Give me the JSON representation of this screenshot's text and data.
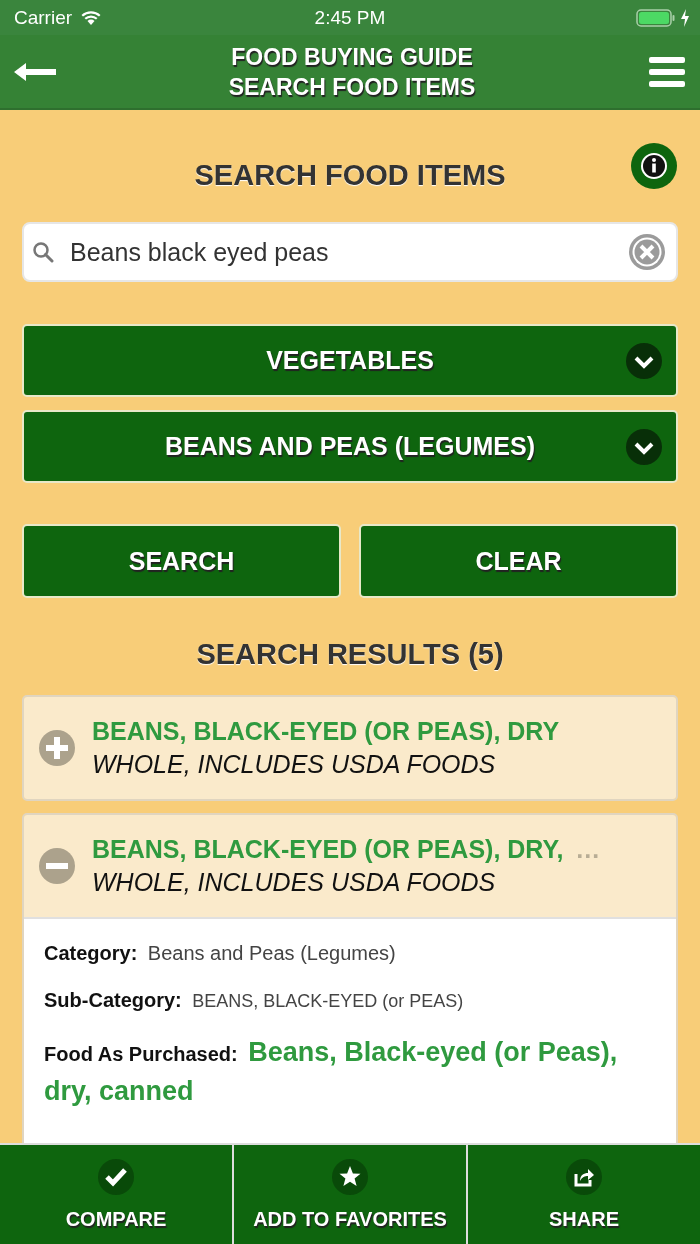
{
  "status_bar": {
    "carrier": "Carrier",
    "time": "2:45 PM",
    "charging": true
  },
  "header": {
    "title_lines": [
      "FOOD BUYING GUIDE",
      "SEARCH FOOD ITEMS"
    ]
  },
  "page_title": "SEARCH FOOD ITEMS",
  "search": {
    "value": "Beans black eyed peas"
  },
  "dropdowns": [
    {
      "label": "VEGETABLES"
    },
    {
      "label": "BEANS AND PEAS (LEGUMES)"
    }
  ],
  "buttons": [
    "SEARCH",
    "CLEAR"
  ],
  "results_title": "SEARCH RESULTS (5)",
  "results": [
    {
      "title": "BEANS, BLACK-EYED (OR PEAS), DRY",
      "subtitle": "WHOLE, INCLUDES USDA FOODS",
      "expanded": false
    },
    {
      "title": "BEANS, BLACK-EYED (OR PEAS), DRY,",
      "more": "…",
      "subtitle": "WHOLE, INCLUDES USDA FOODS",
      "expanded": true,
      "details": [
        {
          "label": "Category:",
          "value": "Beans and Peas (Legumes)",
          "kind": "plain"
        },
        {
          "label": "Sub-Category:",
          "value": "BEANS, BLACK-EYED (or PEAS)",
          "kind": "small"
        },
        {
          "label": "Food As Purchased:",
          "value": "Beans, Black-eyed (or Peas), dry, canned",
          "kind": "highlight"
        }
      ]
    }
  ],
  "bottom_bar": [
    {
      "label": "COMPARE",
      "kind": "check"
    },
    {
      "label": "ADD TO FAVORITES",
      "kind": "star"
    },
    {
      "label": "SHARE",
      "kind": "share"
    }
  ]
}
